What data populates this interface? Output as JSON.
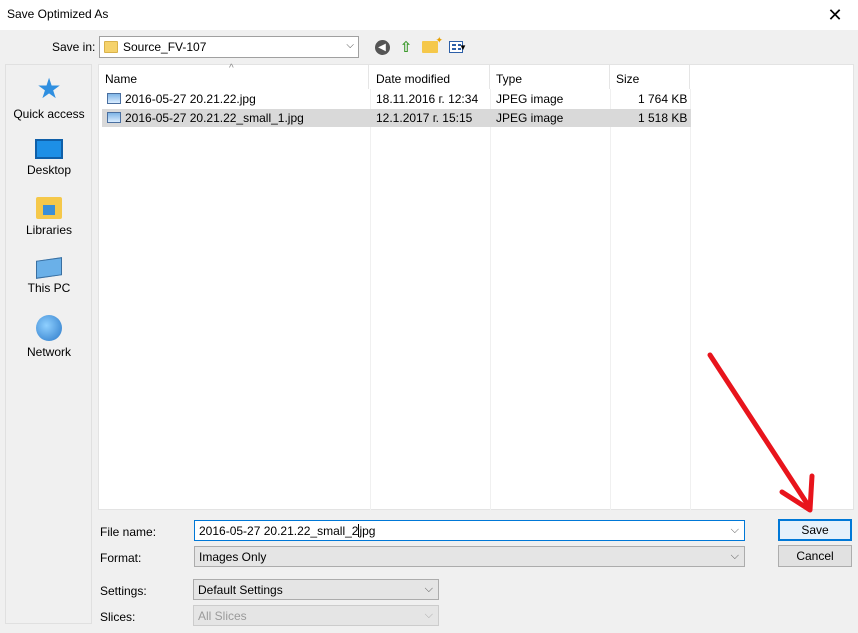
{
  "window": {
    "title": "Save Optimized As"
  },
  "save_in": {
    "label": "Save in:",
    "folder": "Source_FV-107"
  },
  "toolbar": {
    "icons": [
      "back-icon",
      "up-folder-icon",
      "new-folder-icon",
      "view-menu-icon"
    ]
  },
  "places": [
    {
      "label": "Quick access",
      "icon": "star-icon"
    },
    {
      "label": "Desktop",
      "icon": "desktop-icon"
    },
    {
      "label": "Libraries",
      "icon": "libraries-icon"
    },
    {
      "label": "This PC",
      "icon": "computer-icon"
    },
    {
      "label": "Network",
      "icon": "network-icon"
    }
  ],
  "columns": [
    "Name",
    "Date modified",
    "Type",
    "Size"
  ],
  "files": [
    {
      "name": "2016-05-27 20.21.22.jpg",
      "date": "18.11.2016 г. 12:34",
      "type": "JPEG image",
      "size": "1 764 KB",
      "selected": false
    },
    {
      "name": "2016-05-27 20.21.22_small_1.jpg",
      "date": "12.1.2017 г. 15:15",
      "type": "JPEG image",
      "size": "1 518 KB",
      "selected": true
    }
  ],
  "form": {
    "file_name_label": "File name:",
    "file_name_before_caret": "2016-05-27 20.21.22_small_2",
    "file_name_after_caret": "jpg",
    "format_label": "Format:",
    "format_value": "Images Only",
    "settings_label": "Settings:",
    "settings_value": "Default Settings",
    "slices_label": "Slices:",
    "slices_value": "All Slices"
  },
  "buttons": {
    "save": "Save",
    "cancel": "Cancel"
  },
  "colors": {
    "accent": "#0078d7",
    "annotation_arrow": "#e8141c",
    "selection": "#d9d9d9"
  }
}
